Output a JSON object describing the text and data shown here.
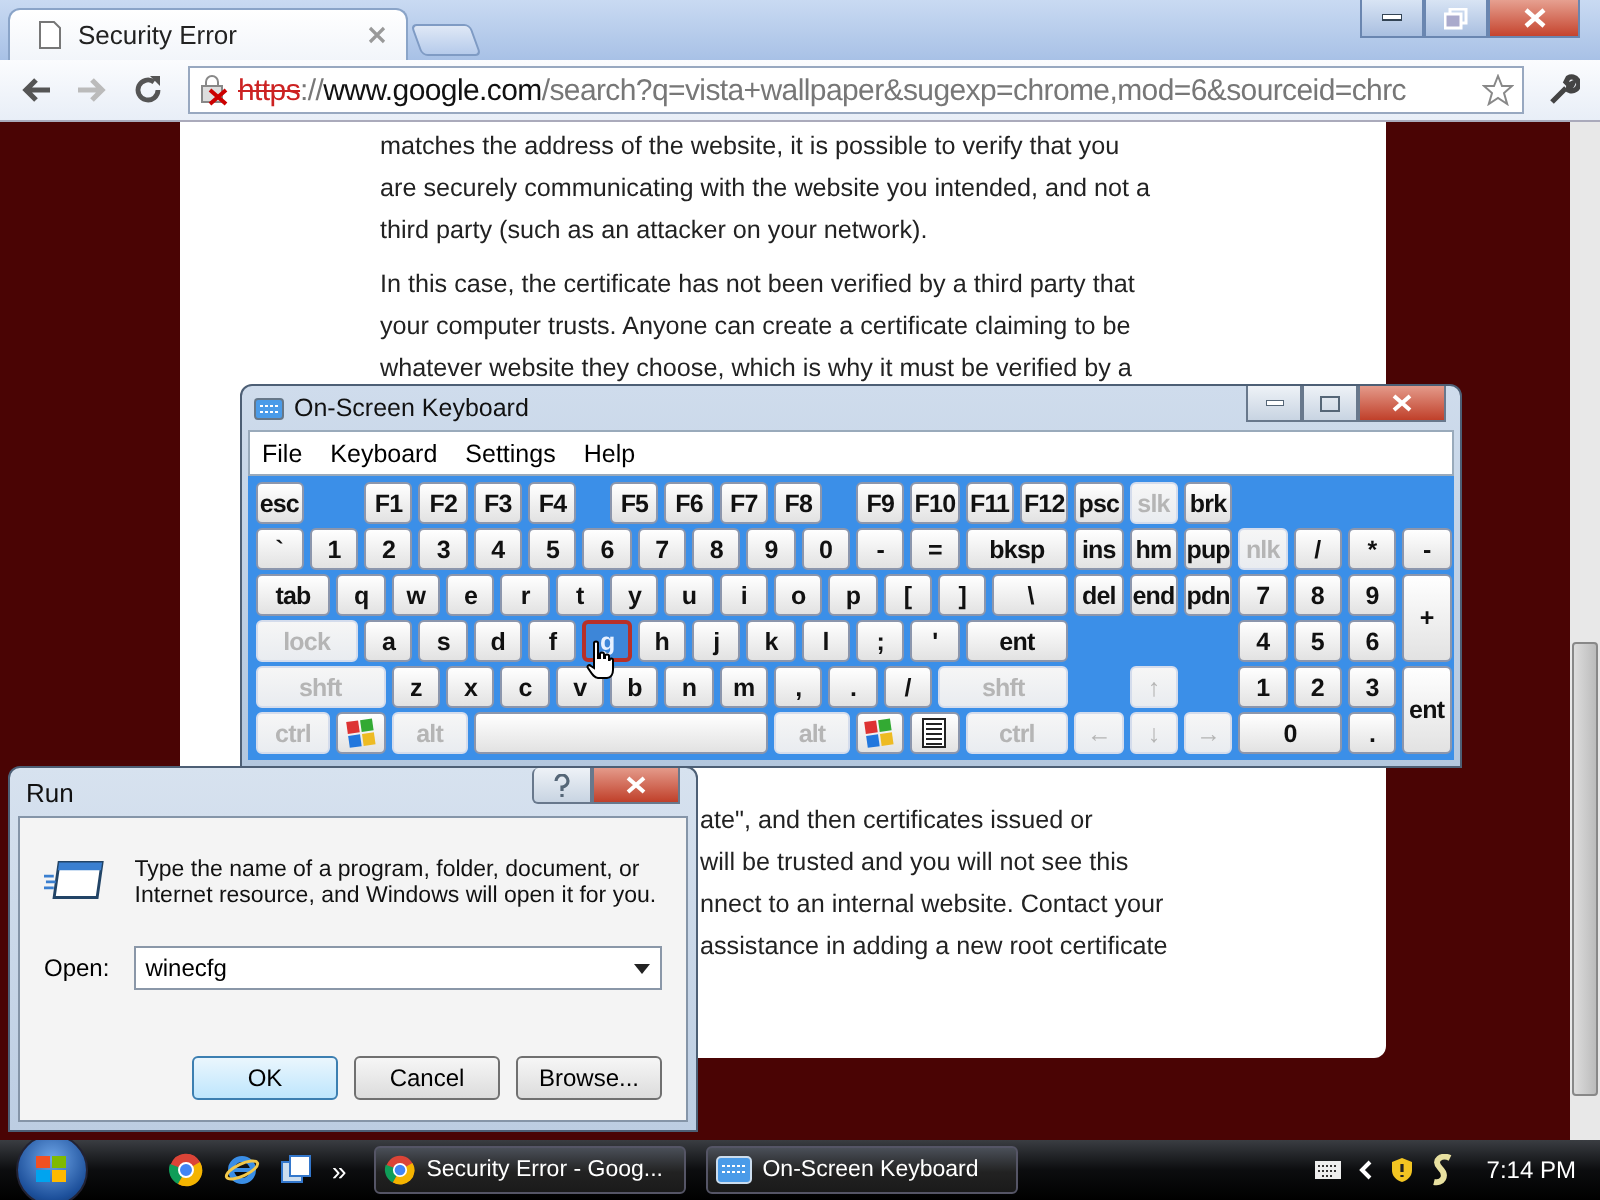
{
  "browser": {
    "tab": {
      "title": "Security Error"
    },
    "url": {
      "scheme": "https",
      "separator": "://",
      "host": "www.google.com",
      "path": "/search?q=vista+wallpaper&sugexp=chrome,mod=6&sourceid=chrc"
    }
  },
  "page": {
    "paragraphs": [
      {
        "lines": [
          "matches the address of the website, it is possible to verify that you",
          "are securely communicating with the website you intended, and not a",
          "third party (such as an attacker on your network)."
        ]
      },
      {
        "lines": [
          "In this case, the certificate has not been verified by a third party that",
          "your computer trusts. Anyone can create a certificate claiming to be",
          "whatever website they choose, which is why it must be verified by a"
        ]
      }
    ],
    "fragment_lines": [
      "ate\", and then certificates issued or",
      "will be trusted and you will not see this",
      "nnect to an internal website. Contact your",
      "assistance in adding a new root certificate"
    ]
  },
  "osk": {
    "title": "On-Screen Keyboard",
    "menu": [
      "File",
      "Keyboard",
      "Settings",
      "Help"
    ],
    "key_rows": [
      [
        {
          "kind": "key",
          "label": "esc",
          "disabled": false,
          "hovered": false
        },
        {
          "kind": "key",
          "label": "F1",
          "disabled": false,
          "hovered": false
        },
        {
          "kind": "key",
          "label": "F2",
          "disabled": false,
          "hovered": false
        },
        {
          "kind": "key",
          "label": "F3",
          "disabled": false,
          "hovered": false
        },
        {
          "kind": "key",
          "label": "F4",
          "disabled": false,
          "hovered": false
        },
        {
          "kind": "key",
          "label": "F5",
          "disabled": false,
          "hovered": false
        },
        {
          "kind": "key",
          "label": "F6",
          "disabled": false,
          "hovered": false
        },
        {
          "kind": "key",
          "label": "F7",
          "disabled": false,
          "hovered": false
        },
        {
          "kind": "key",
          "label": "F8",
          "disabled": false,
          "hovered": false
        },
        {
          "kind": "key",
          "label": "F9",
          "disabled": false,
          "hovered": false
        },
        {
          "kind": "key",
          "label": "F10",
          "disabled": false,
          "hovered": false
        },
        {
          "kind": "key",
          "label": "F11",
          "disabled": false,
          "hovered": false
        },
        {
          "kind": "key",
          "label": "F12",
          "disabled": false,
          "hovered": false
        },
        {
          "kind": "key",
          "label": "psc",
          "disabled": false,
          "hovered": false
        },
        {
          "kind": "key",
          "label": "slk",
          "disabled": true,
          "hovered": false
        },
        {
          "kind": "key",
          "label": "brk",
          "disabled": false,
          "hovered": false
        }
      ],
      [
        {
          "kind": "key",
          "label": "`",
          "disabled": false,
          "hovered": false
        },
        {
          "kind": "key",
          "label": "1",
          "disabled": false,
          "hovered": false
        },
        {
          "kind": "key",
          "label": "2",
          "disabled": false,
          "hovered": false
        },
        {
          "kind": "key",
          "label": "3",
          "disabled": false,
          "hovered": false
        },
        {
          "kind": "key",
          "label": "4",
          "disabled": false,
          "hovered": false
        },
        {
          "kind": "key",
          "label": "5",
          "disabled": false,
          "hovered": false
        },
        {
          "kind": "key",
          "label": "6",
          "disabled": false,
          "hovered": false
        },
        {
          "kind": "key",
          "label": "7",
          "disabled": false,
          "hovered": false
        },
        {
          "kind": "key",
          "label": "8",
          "disabled": false,
          "hovered": false
        },
        {
          "kind": "key",
          "label": "9",
          "disabled": false,
          "hovered": false
        },
        {
          "kind": "key",
          "label": "0",
          "disabled": false,
          "hovered": false
        },
        {
          "kind": "key",
          "label": "-",
          "disabled": false,
          "hovered": false
        },
        {
          "kind": "key",
          "label": "=",
          "disabled": false,
          "hovered": false
        },
        {
          "kind": "key",
          "label": "bksp",
          "disabled": false,
          "hovered": false
        },
        {
          "kind": "key",
          "label": "ins",
          "disabled": false,
          "hovered": false
        },
        {
          "kind": "key",
          "label": "hm",
          "disabled": false,
          "hovered": false
        },
        {
          "kind": "key",
          "label": "pup",
          "disabled": false,
          "hovered": false
        },
        {
          "kind": "key",
          "label": "nlk",
          "disabled": true,
          "hovered": false
        },
        {
          "kind": "key",
          "label": "/",
          "disabled": false,
          "hovered": false
        },
        {
          "kind": "key",
          "label": "*",
          "disabled": false,
          "hovered": false
        },
        {
          "kind": "key",
          "label": "-",
          "disabled": false,
          "hovered": false
        }
      ],
      [
        {
          "kind": "key",
          "label": "tab",
          "disabled": false,
          "hovered": false
        },
        {
          "kind": "key",
          "label": "q",
          "disabled": false,
          "hovered": false
        },
        {
          "kind": "key",
          "label": "w",
          "disabled": false,
          "hovered": false
        },
        {
          "kind": "key",
          "label": "e",
          "disabled": false,
          "hovered": false
        },
        {
          "kind": "key",
          "label": "r",
          "disabled": false,
          "hovered": false
        },
        {
          "kind": "key",
          "label": "t",
          "disabled": false,
          "hovered": false
        },
        {
          "kind": "key",
          "label": "y",
          "disabled": false,
          "hovered": false
        },
        {
          "kind": "key",
          "label": "u",
          "disabled": false,
          "hovered": false
        },
        {
          "kind": "key",
          "label": "i",
          "disabled": false,
          "hovered": false
        },
        {
          "kind": "key",
          "label": "o",
          "disabled": false,
          "hovered": false
        },
        {
          "kind": "key",
          "label": "p",
          "disabled": false,
          "hovered": false
        },
        {
          "kind": "key",
          "label": "[",
          "disabled": false,
          "hovered": false
        },
        {
          "kind": "key",
          "label": "]",
          "disabled": false,
          "hovered": false
        },
        {
          "kind": "key",
          "label": "\\",
          "disabled": false,
          "hovered": false
        },
        {
          "kind": "key",
          "label": "del",
          "disabled": false,
          "hovered": false
        },
        {
          "kind": "key",
          "label": "end",
          "disabled": false,
          "hovered": false
        },
        {
          "kind": "key",
          "label": "pdn",
          "disabled": false,
          "hovered": false
        },
        {
          "kind": "key",
          "label": "7",
          "disabled": false,
          "hovered": false
        },
        {
          "kind": "key",
          "label": "8",
          "disabled": false,
          "hovered": false
        },
        {
          "kind": "key",
          "label": "9",
          "disabled": false,
          "hovered": false
        },
        {
          "kind": "key",
          "label": "+",
          "disabled": false,
          "hovered": false
        }
      ],
      [
        {
          "kind": "key",
          "label": "lock",
          "disabled": true,
          "hovered": false
        },
        {
          "kind": "key",
          "label": "a",
          "disabled": false,
          "hovered": false
        },
        {
          "kind": "key",
          "label": "s",
          "disabled": false,
          "hovered": false
        },
        {
          "kind": "key",
          "label": "d",
          "disabled": false,
          "hovered": false
        },
        {
          "kind": "key",
          "label": "f",
          "disabled": false,
          "hovered": false
        },
        {
          "kind": "key",
          "label": "g",
          "disabled": false,
          "hovered": true
        },
        {
          "kind": "key",
          "label": "h",
          "disabled": false,
          "hovered": false
        },
        {
          "kind": "key",
          "label": "j",
          "disabled": false,
          "hovered": false
        },
        {
          "kind": "key",
          "label": "k",
          "disabled": false,
          "hovered": false
        },
        {
          "kind": "key",
          "label": "l",
          "disabled": false,
          "hovered": false
        },
        {
          "kind": "key",
          "label": ";",
          "disabled": false,
          "hovered": false
        },
        {
          "kind": "key",
          "label": "'",
          "disabled": false,
          "hovered": false
        },
        {
          "kind": "key",
          "label": "ent",
          "disabled": false,
          "hovered": false
        },
        {
          "kind": "key",
          "label": "4",
          "disabled": false,
          "hovered": false
        },
        {
          "kind": "key",
          "label": "5",
          "disabled": false,
          "hovered": false
        },
        {
          "kind": "key",
          "label": "6",
          "disabled": false,
          "hovered": false
        }
      ],
      [
        {
          "kind": "key",
          "label": "shft",
          "disabled": true,
          "hovered": false
        },
        {
          "kind": "key",
          "label": "z",
          "disabled": false,
          "hovered": false
        },
        {
          "kind": "key",
          "label": "x",
          "disabled": false,
          "hovered": false
        },
        {
          "kind": "key",
          "label": "c",
          "disabled": false,
          "hovered": false
        },
        {
          "kind": "key",
          "label": "v",
          "disabled": false,
          "hovered": false
        },
        {
          "kind": "key",
          "label": "b",
          "disabled": false,
          "hovered": false
        },
        {
          "kind": "key",
          "label": "n",
          "disabled": false,
          "hovered": false
        },
        {
          "kind": "key",
          "label": "m",
          "disabled": false,
          "hovered": false
        },
        {
          "kind": "key",
          "label": ",",
          "disabled": false,
          "hovered": false
        },
        {
          "kind": "key",
          "label": ".",
          "disabled": false,
          "hovered": false
        },
        {
          "kind": "key",
          "label": "/",
          "disabled": false,
          "hovered": false
        },
        {
          "kind": "key",
          "label": "shft",
          "disabled": true,
          "hovered": false
        },
        {
          "kind": "key",
          "label": "↑",
          "disabled": true,
          "hovered": false
        },
        {
          "kind": "key",
          "label": "1",
          "disabled": false,
          "hovered": false
        },
        {
          "kind": "key",
          "label": "2",
          "disabled": false,
          "hovered": false
        },
        {
          "kind": "key",
          "label": "3",
          "disabled": false,
          "hovered": false
        },
        {
          "kind": "key",
          "label": "ent",
          "disabled": false,
          "hovered": false
        }
      ],
      [
        {
          "kind": "key",
          "label": "ctrl",
          "disabled": true,
          "hovered": false
        },
        {
          "kind": "logo",
          "disabled": false,
          "hovered": false
        },
        {
          "kind": "key",
          "label": "alt",
          "disabled": true,
          "hovered": false
        },
        {
          "kind": "space",
          "disabled": false,
          "hovered": false
        },
        {
          "kind": "key",
          "label": "alt",
          "disabled": true,
          "hovered": false
        },
        {
          "kind": "logo",
          "disabled": false,
          "hovered": false
        },
        {
          "kind": "menu",
          "disabled": false,
          "hovered": false
        },
        {
          "kind": "key",
          "label": "ctrl",
          "disabled": true,
          "hovered": false
        },
        {
          "kind": "key",
          "label": "←",
          "disabled": true,
          "hovered": false
        },
        {
          "kind": "key",
          "label": "↓",
          "disabled": true,
          "hovered": false
        },
        {
          "kind": "key",
          "label": "→",
          "disabled": true,
          "hovered": false
        },
        {
          "kind": "key",
          "label": "0",
          "disabled": false,
          "hovered": false
        },
        {
          "kind": "key",
          "label": ".",
          "disabled": false,
          "hovered": false
        }
      ]
    ]
  },
  "run": {
    "title": "Run",
    "message": "Type the name of a program, folder, document, or Internet resource, and Windows will open it for you.",
    "open_label": "Open:",
    "value": "winecfg",
    "buttons": [
      {
        "label": "OK",
        "default": true
      },
      {
        "label": "Cancel",
        "default": false
      },
      {
        "label": "Browse...",
        "default": false
      }
    ]
  },
  "taskbar": {
    "overflow": "»",
    "tasks": [
      "Security Error - Goog...",
      "On-Screen Keyboard"
    ],
    "clock": "7:14 PM"
  }
}
